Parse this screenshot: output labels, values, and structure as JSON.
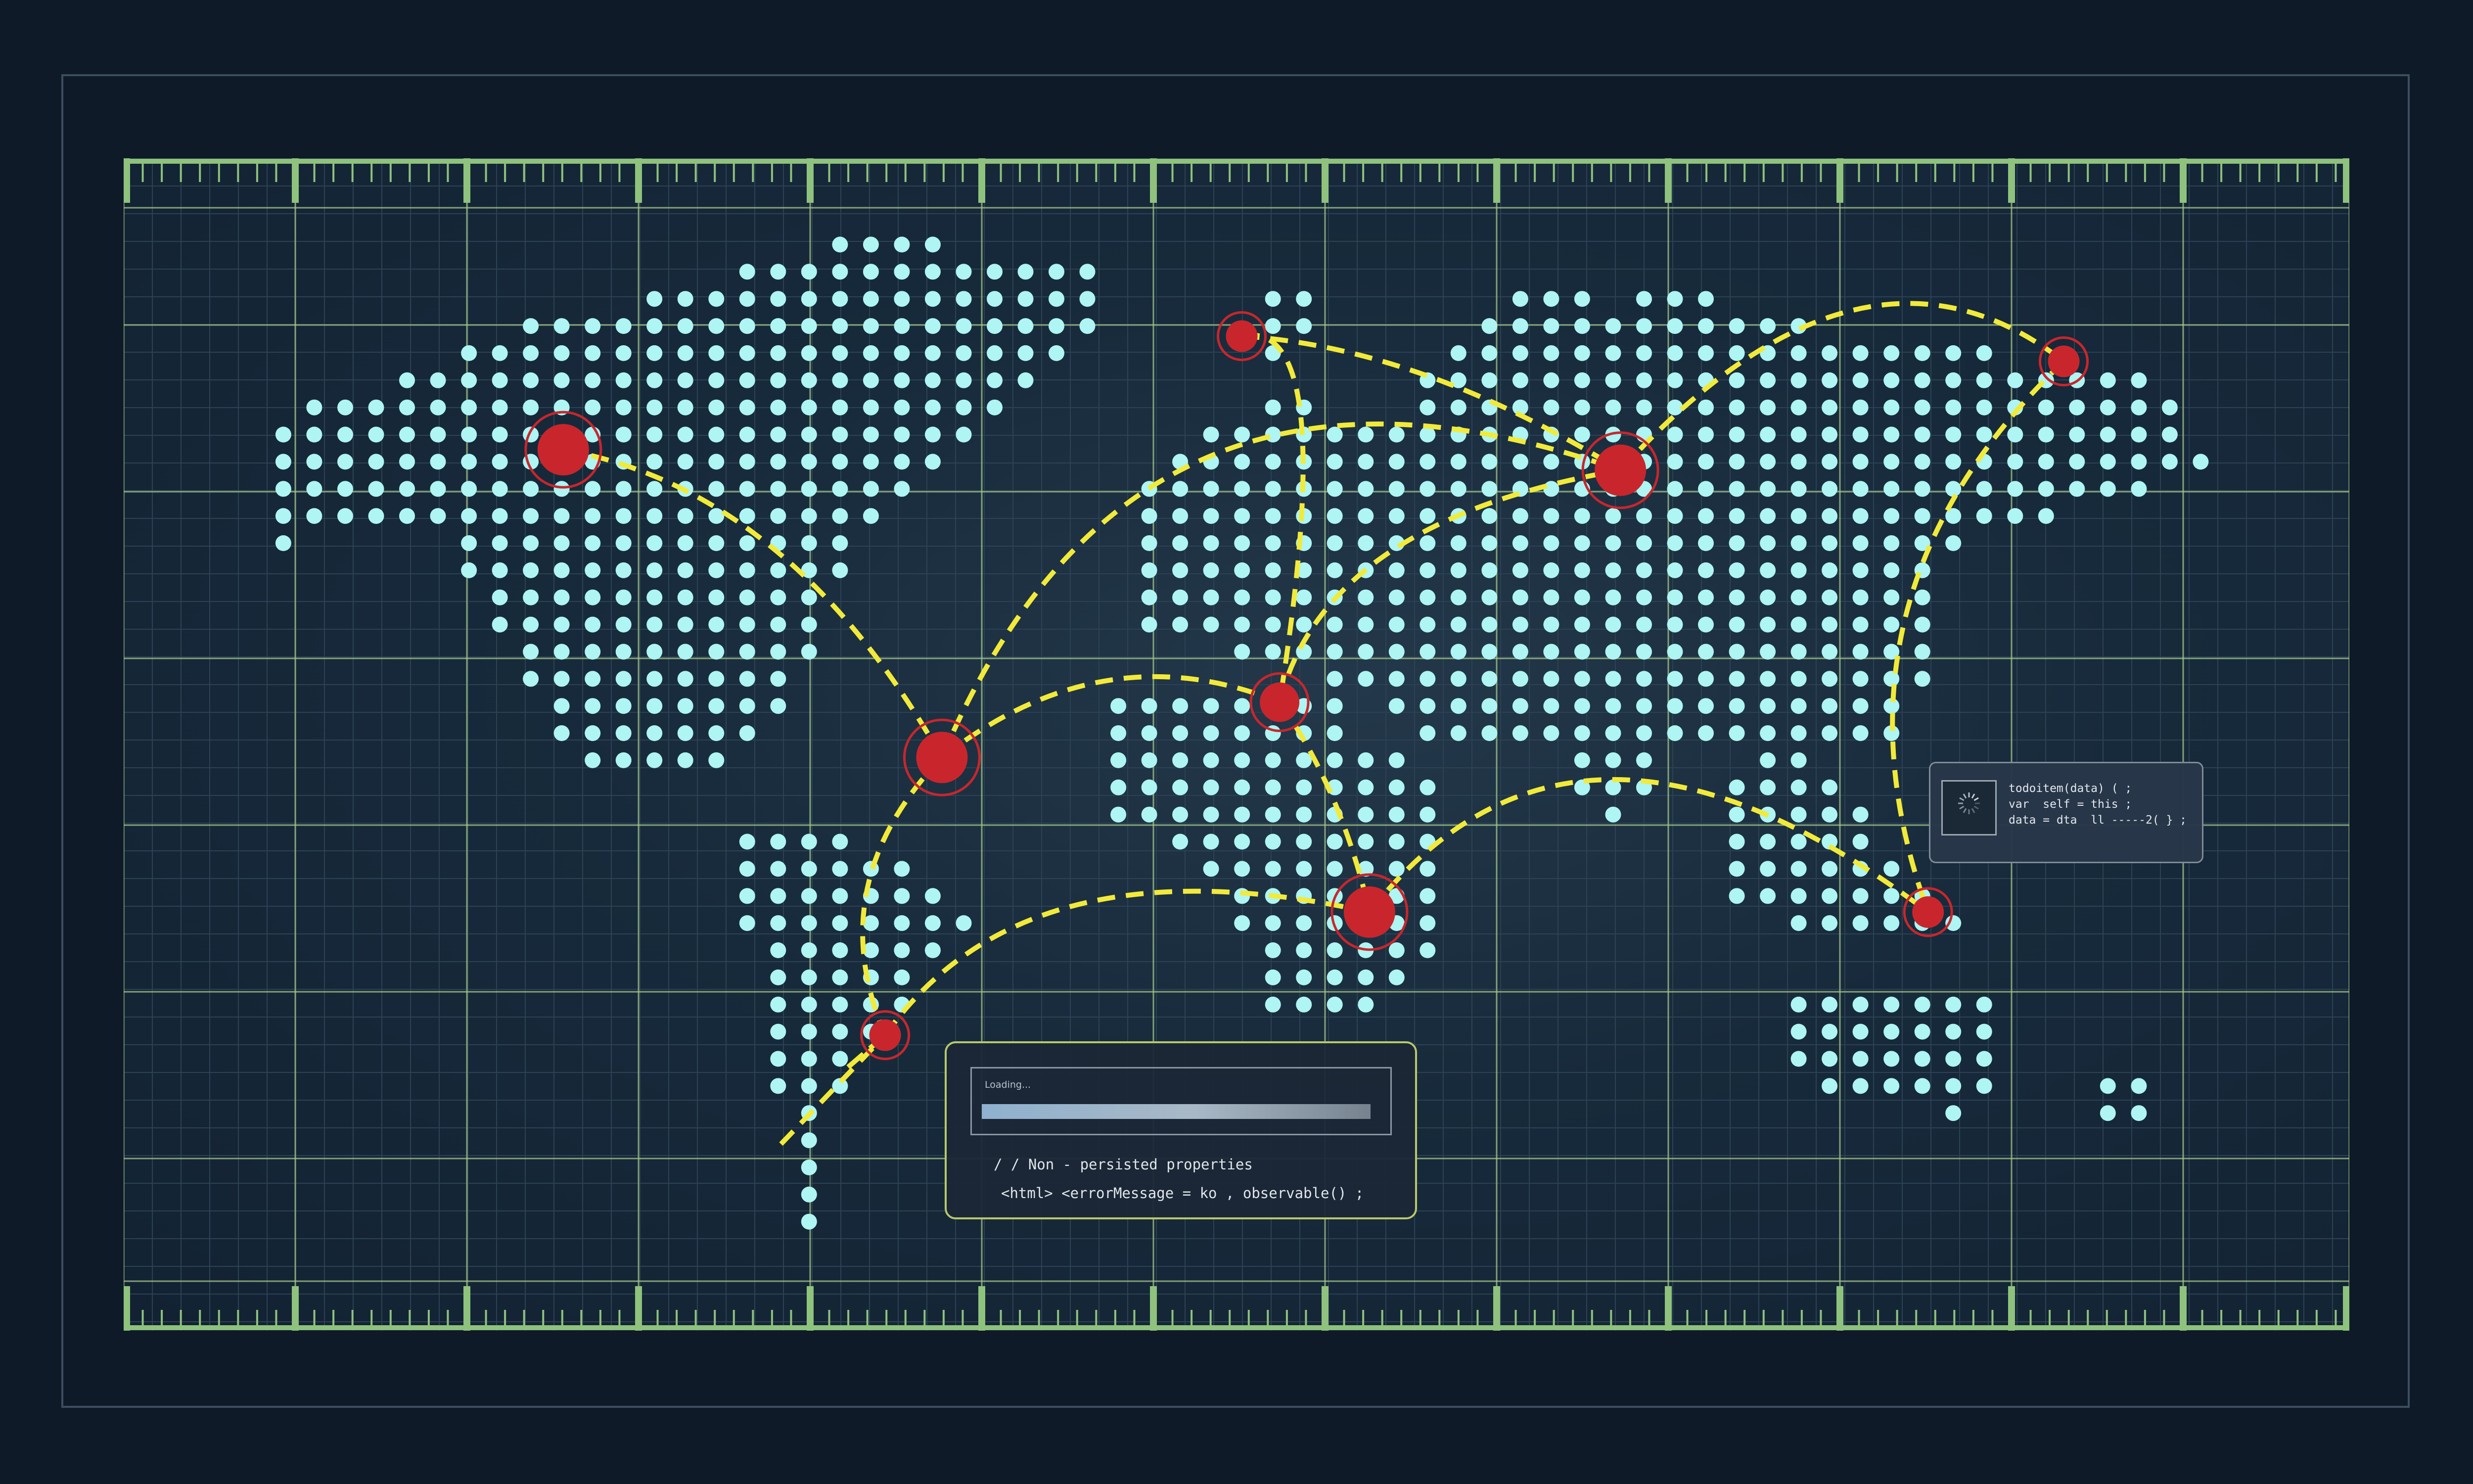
{
  "colors": {
    "background": "#0e1a28",
    "map_background": "#172a3b",
    "dot": "#aef5f3",
    "grid_major": "#a6c98a",
    "ruler": "#8ec27d",
    "route": "#f2ea3a",
    "node": "#c8262c",
    "panel_border": "#b7c96b"
  },
  "loading_panel": {
    "label": "Loading...",
    "progress_percent": 100,
    "line_1": "/ / Non - persisted properties",
    "line_2": "<html> <errorMessage = ko , observable() ;"
  },
  "code_panel": {
    "spinner_icon": "loading-spinner-icon",
    "line_1": "todoitem(data) ( ;",
    "line_2": "var  self = this ;",
    "line_3": "data = dta  ll -----2( } ;"
  },
  "map": {
    "nodes": [
      {
        "name": "node-north-america",
        "size": "large"
      },
      {
        "name": "node-greenland",
        "size": "small"
      },
      {
        "name": "node-atlantic",
        "size": "large"
      },
      {
        "name": "node-south-america",
        "size": "small"
      },
      {
        "name": "node-north-africa",
        "size": "medium"
      },
      {
        "name": "node-central-africa",
        "size": "large"
      },
      {
        "name": "node-russia",
        "size": "large"
      },
      {
        "name": "node-east-asia",
        "size": "small"
      },
      {
        "name": "node-southeast-asia",
        "size": "small"
      }
    ]
  }
}
